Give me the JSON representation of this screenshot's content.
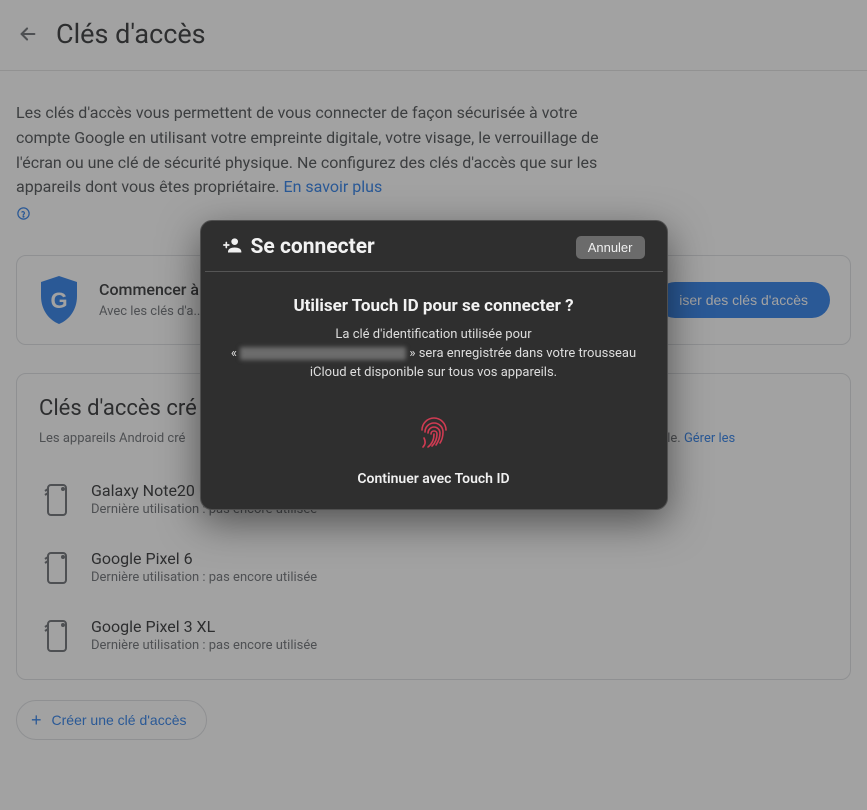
{
  "header": {
    "title": "Clés d'accès"
  },
  "intro": {
    "text": "Les clés d'accès vous permettent de vous connecter de façon sécurisée à votre compte Google en utilisant votre empreinte digitale, votre visage, le verrouillage de l'écran ou une clé de sécurité physique. Ne configurez des clés d'accès que sur les appareils dont vous êtes propriétaire. ",
    "learn_more": "En savoir plus"
  },
  "get_started": {
    "title": "Commencer à",
    "subtitle": "Avec les clés d'a... votre visage ou le",
    "button": "iser des clés d'accès"
  },
  "created": {
    "title": "Clés d'accès cré",
    "subtitle_prefix": "Les appareils Android cré",
    "subtitle_suffix": "ectez à votre compte Google. ",
    "manage_link": "Gérer les",
    "devices": [
      {
        "name": "Galaxy Note20 Ultra 5G",
        "sub": "Dernière utilisation : pas encore utilisée"
      },
      {
        "name": "Google Pixel 6",
        "sub": "Dernière utilisation : pas encore utilisée"
      },
      {
        "name": "Google Pixel 3 XL",
        "sub": "Dernière utilisation : pas encore utilisée"
      }
    ]
  },
  "create_button": "Créer une clé d'accès",
  "modal": {
    "title": "Se connecter",
    "cancel": "Annuler",
    "question": "Utiliser Touch ID pour se connecter ?",
    "desc_line1": "La clé d'identification utilisée pour",
    "desc_prefix": "« ",
    "desc_suffix": " » sera enregistrée dans votre trousseau iCloud et disponible sur tous vos appareils.",
    "continue": "Continuer avec Touch ID"
  }
}
